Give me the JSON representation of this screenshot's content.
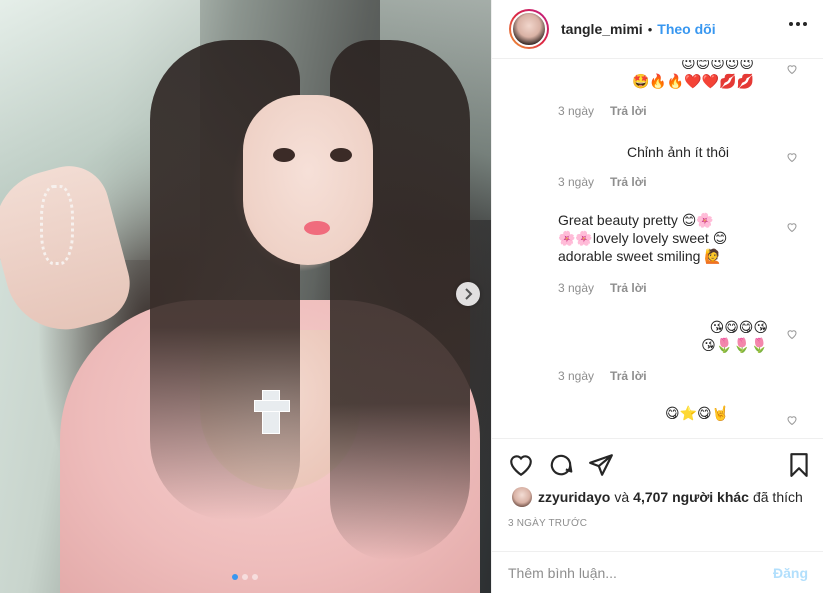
{
  "post": {
    "photo_alt": "selfie photo",
    "carousel_count": 3,
    "carousel_active": 1
  },
  "header": {
    "username": "tangle_mimi",
    "separator": "•",
    "follow_label": "Theo dõi"
  },
  "comments": [
    {
      "text": "😉😊😉😉😉\n🤩🔥🔥❤️❤️💋💋",
      "time": "3 ngày",
      "reply": "Trả lời"
    },
    {
      "text": "Chỉnh ảnh ít thôi",
      "time": "3 ngày",
      "reply": "Trả lời"
    },
    {
      "text": "Great beauty pretty 😊🌸\n🌸🌸lovely lovely sweet 😊\nadorable sweet smiling 🙋",
      "time": "3 ngày",
      "reply": "Trả lời"
    },
    {
      "text": "😘😋😋😘\n😘🌷🌷🌷",
      "time": "3 ngày",
      "reply": "Trả lời"
    },
    {
      "text": "😋⭐😋🤘",
      "time": "",
      "reply": ""
    }
  ],
  "likes": {
    "user": "zzyuridayo",
    "and": "và",
    "count": "4,707 người khác",
    "suffix": "đã thích"
  },
  "time_ago": "3 NGÀY TRƯỚC",
  "add_comment": {
    "placeholder": "Thêm bình luận...",
    "post_label": "Đăng"
  },
  "icons": {
    "like": "heart-icon",
    "comment": "comment-icon",
    "share": "share-icon",
    "save": "bookmark-icon"
  }
}
